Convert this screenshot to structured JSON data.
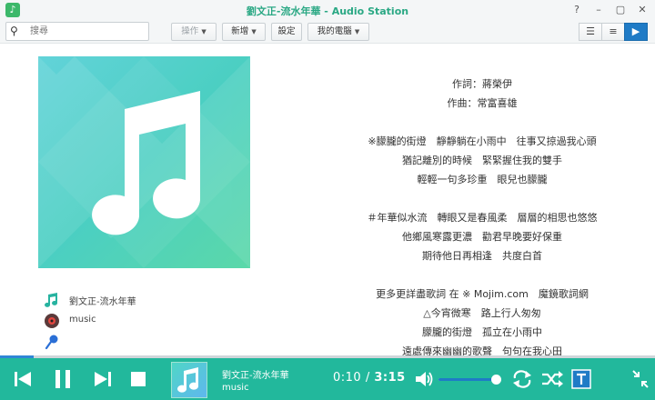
{
  "window": {
    "title": "劉文正-流水年華 - Audio Station"
  },
  "toolbar": {
    "search_placeholder": "搜尋",
    "operations_label": "操作",
    "add_label": "新增",
    "settings_label": "設定",
    "my_computer_label": "我的電腦"
  },
  "track": {
    "title": "劉文正-流水年華",
    "artist": "music"
  },
  "lyrics": [
    "作詞：蔣榮伊",
    "作曲：常富喜雄",
    "",
    "※朦朧的街燈　靜靜躺在小雨中　往事又掠過我心頭",
    "猶記離別的時候　緊緊握住我的雙手",
    "輕輕一句多珍重　眼兒也朦朧",
    "",
    "＃年華似水流　轉眼又是春風柔　層層的相思也悠悠",
    "他鄉風寒露更濃　勸君早晚要好保重",
    "期待他日再相逢　共度白首",
    "",
    "更多更詳盡歌詞 在 ※ Mojim.com　魔鏡歌詞網",
    "△今宵微寒　路上行人匆匆",
    "朦朧的街燈　孤立在小雨中",
    "遠處傳來幽幽的歌聲　句句在我心田"
  ],
  "player": {
    "current_time": "0:10",
    "separator": " / ",
    "total_time": "3:15",
    "playback_progress": 0.051,
    "volume_level": 0.92
  },
  "colors": {
    "player_bar": "#22b89c",
    "title_accent": "#2aa884",
    "active_view": "#1f7bc6",
    "progress": "#2f86d6"
  },
  "icons": {
    "note": "music-note-icon",
    "disc": "disc-icon",
    "mic": "microphone-icon"
  }
}
